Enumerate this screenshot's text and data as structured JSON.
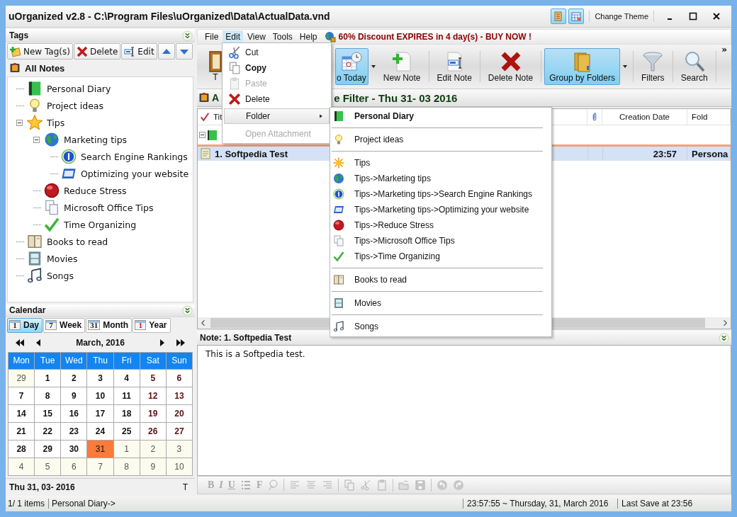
{
  "window": {
    "title": "uOrganized v2.8 - C:\\Program Files\\uOrganized\\Data\\ActualData.vnd",
    "theme_button": "Change Theme"
  },
  "tags_panel": {
    "title": "Tags",
    "buttons": [
      {
        "label": "New Tag(s)",
        "kind": "new"
      },
      {
        "label": "Delete",
        "kind": "delete"
      },
      {
        "label": "Edit",
        "kind": "edit"
      },
      {
        "kind": "up"
      },
      {
        "kind": "down"
      }
    ],
    "root": "All Notes",
    "tree": [
      {
        "label": "Personal Diary"
      },
      {
        "label": "Project ideas"
      },
      {
        "label": "Tips",
        "expanded": true,
        "children": [
          {
            "label": "Marketing tips",
            "expanded": true,
            "children": [
              {
                "label": "Search Engine Rankings"
              },
              {
                "label": "Optimizing your website"
              }
            ]
          },
          {
            "label": "Reduce Stress"
          },
          {
            "label": "Microsoft Office Tips"
          },
          {
            "label": "Time Organizing"
          }
        ]
      },
      {
        "label": "Books to read"
      },
      {
        "label": "Movies"
      },
      {
        "label": "Songs"
      }
    ]
  },
  "calendar": {
    "title": "Calendar",
    "views": [
      {
        "icon_text": "1",
        "label": "Day",
        "selected": true
      },
      {
        "icon_text": "7",
        "label": "Week",
        "selected": false
      },
      {
        "icon_text": "31",
        "label": "Month",
        "selected": false
      },
      {
        "icon_text": "1",
        "label": "Year",
        "selected": false
      }
    ],
    "month": "March, 2016",
    "weekdays": [
      "Mon",
      "Tue",
      "Wed",
      "Thu",
      "Fri",
      "Sat",
      "Sun"
    ],
    "weeks": [
      [
        {
          "d": "29",
          "other": true,
          "selected": false
        },
        {
          "d": "1",
          "other": false,
          "selected": false
        },
        {
          "d": "2",
          "other": false,
          "selected": false
        },
        {
          "d": "3",
          "other": false,
          "selected": false
        },
        {
          "d": "4",
          "other": false,
          "selected": false
        },
        {
          "d": "5",
          "other": false,
          "selected": false
        },
        {
          "d": "6",
          "other": false,
          "selected": false
        }
      ],
      [
        {
          "d": "7",
          "other": false,
          "selected": false
        },
        {
          "d": "8",
          "other": false,
          "selected": false
        },
        {
          "d": "9",
          "other": false,
          "selected": false
        },
        {
          "d": "10",
          "other": false,
          "selected": false
        },
        {
          "d": "11",
          "other": false,
          "selected": false
        },
        {
          "d": "12",
          "other": false,
          "selected": false
        },
        {
          "d": "13",
          "other": false,
          "selected": false
        }
      ],
      [
        {
          "d": "14",
          "other": false,
          "selected": false
        },
        {
          "d": "15",
          "other": false,
          "selected": false
        },
        {
          "d": "16",
          "other": false,
          "selected": false
        },
        {
          "d": "17",
          "other": false,
          "selected": false
        },
        {
          "d": "18",
          "other": false,
          "selected": false
        },
        {
          "d": "19",
          "other": false,
          "selected": false
        },
        {
          "d": "20",
          "other": false,
          "selected": false
        }
      ],
      [
        {
          "d": "21",
          "other": false,
          "selected": false
        },
        {
          "d": "22",
          "other": false,
          "selected": false
        },
        {
          "d": "23",
          "other": false,
          "selected": false
        },
        {
          "d": "24",
          "other": false,
          "selected": false
        },
        {
          "d": "25",
          "other": false,
          "selected": false
        },
        {
          "d": "26",
          "other": false,
          "selected": false
        },
        {
          "d": "27",
          "other": false,
          "selected": false
        }
      ],
      [
        {
          "d": "28",
          "other": false,
          "selected": false
        },
        {
          "d": "29",
          "other": false,
          "selected": false
        },
        {
          "d": "30",
          "other": false,
          "selected": false
        },
        {
          "d": "31",
          "other": false,
          "selected": true
        },
        {
          "d": "1",
          "other": true,
          "selected": false
        },
        {
          "d": "2",
          "other": true,
          "selected": false
        },
        {
          "d": "3",
          "other": true,
          "selected": false
        }
      ],
      [
        {
          "d": "4",
          "other": true,
          "selected": false
        },
        {
          "d": "5",
          "other": true,
          "selected": false
        },
        {
          "d": "6",
          "other": true,
          "selected": false
        },
        {
          "d": "7",
          "other": true,
          "selected": false
        },
        {
          "d": "8",
          "other": true,
          "selected": false
        },
        {
          "d": "9",
          "other": true,
          "selected": false
        },
        {
          "d": "10",
          "other": true,
          "selected": false
        }
      ]
    ],
    "footer_date": "Thu 31, 03- 2016",
    "footer_key": "T"
  },
  "menubar": {
    "items": [
      {
        "label": "File",
        "selected": false
      },
      {
        "label": "Edit",
        "selected": true
      },
      {
        "label": "View",
        "selected": false
      },
      {
        "label": "Tools",
        "selected": false
      },
      {
        "label": "Help",
        "selected": false
      }
    ],
    "promo": "60% Discount EXPIRES in 4 day(s) - BUY NOW !"
  },
  "toolbar": {
    "buttons": [
      {
        "label": "T",
        "kind": "book",
        "selected": false,
        "dropdown": false
      },
      {
        "label": "o Today",
        "kind": "today",
        "selected": true,
        "dropdown": true
      },
      {
        "label": "New Note",
        "kind": "new",
        "selected": false,
        "dropdown": false
      },
      {
        "label": "Edit Note",
        "kind": "edit",
        "selected": false,
        "dropdown": false
      },
      {
        "label": "Delete Note",
        "kind": "delete",
        "selected": false,
        "dropdown": false
      },
      {
        "label": "Group by Folders",
        "kind": "folders",
        "selected": true,
        "dropdown": true
      },
      {
        "label": "Filters",
        "kind": "filter",
        "selected": false,
        "dropdown": false
      },
      {
        "label": "Search",
        "kind": "search",
        "selected": false,
        "dropdown": false
      }
    ],
    "overflow": "»"
  },
  "filter_bar": {
    "lead": "A",
    "tail": "e Filter -  Thu 31- 03 2016"
  },
  "table": {
    "columns": [
      {
        "label": "Tit",
        "kind": "title"
      },
      {
        "kind": "attachment"
      },
      {
        "label": "Creation Date",
        "kind": "date"
      },
      {
        "label": "Fold",
        "kind": "folder"
      }
    ],
    "group": {
      "expanded": true
    },
    "rows": [
      {
        "title": "1. Softpedia Test",
        "created": "23:57",
        "folder": "Persona",
        "selected": true
      }
    ]
  },
  "note": {
    "title": "Note: 1. Softpedia Test",
    "body": "This is a Softpedia test.",
    "tools": [
      {
        "kind": "bold",
        "label": "B",
        "disabled": true
      },
      {
        "kind": "italic",
        "label": "I",
        "disabled": true
      },
      {
        "kind": "underline",
        "label": "U",
        "disabled": true
      },
      {
        "kind": "list",
        "disabled": true
      },
      {
        "kind": "font",
        "label": "F",
        "disabled": true
      },
      {
        "kind": "paint",
        "disabled": true
      },
      {
        "kind": "sep"
      },
      {
        "kind": "left",
        "disabled": true
      },
      {
        "kind": "center",
        "disabled": true
      },
      {
        "kind": "right",
        "disabled": true
      },
      {
        "kind": "sep"
      },
      {
        "kind": "copy",
        "disabled": true
      },
      {
        "kind": "cut",
        "disabled": true
      },
      {
        "kind": "paste",
        "disabled": true
      },
      {
        "kind": "sep"
      },
      {
        "kind": "open",
        "disabled": true
      },
      {
        "kind": "save",
        "disabled": true
      },
      {
        "kind": "sep"
      },
      {
        "kind": "undo",
        "disabled": true
      },
      {
        "kind": "redo",
        "disabled": true
      }
    ]
  },
  "status_bar": {
    "count": "1/ 1 items",
    "path": "Personal Diary->",
    "clock": "23:57:55  ~  Thursday, 31, March 2016",
    "last_save": "Last Save at 23:56"
  },
  "edit_menu": {
    "items": [
      {
        "label": "Cut",
        "kind": "cut",
        "disabled": false,
        "selected": false,
        "default": false
      },
      {
        "label": "Copy",
        "kind": "copy",
        "disabled": false,
        "selected": false,
        "default": true
      },
      {
        "label": "Paste",
        "kind": "paste",
        "disabled": true,
        "selected": false,
        "default": false
      },
      {
        "label": "Delete",
        "kind": "delete",
        "disabled": false,
        "selected": false,
        "default": false
      },
      {
        "label": "Folder",
        "kind": "submenu",
        "disabled": false,
        "selected": true,
        "default": false
      },
      {
        "label": "Open Attachment",
        "kind": "plain",
        "disabled": true,
        "selected": false,
        "default": false
      }
    ]
  },
  "folder_menu": {
    "groups": [
      [
        {
          "label": "Personal Diary",
          "selected": true
        }
      ],
      [
        {
          "label": "Project ideas",
          "selected": false
        }
      ],
      [
        {
          "label": "Tips",
          "selected": false
        },
        {
          "label": "Tips->Marketing tips",
          "selected": false
        },
        {
          "label": "Tips->Marketing tips->Search Engine Rankings",
          "selected": false
        },
        {
          "label": "Tips->Marketing tips->Optimizing your website",
          "selected": false
        },
        {
          "label": "Tips->Reduce Stress",
          "selected": false
        },
        {
          "label": "Tips->Microsoft Office Tips",
          "selected": false
        },
        {
          "label": "Tips->Time Organizing",
          "selected": false
        }
      ],
      [
        {
          "label": "Books to read",
          "selected": false
        }
      ],
      [
        {
          "label": "Movies",
          "selected": false
        }
      ],
      [
        {
          "label": "Songs",
          "selected": false
        }
      ]
    ]
  }
}
